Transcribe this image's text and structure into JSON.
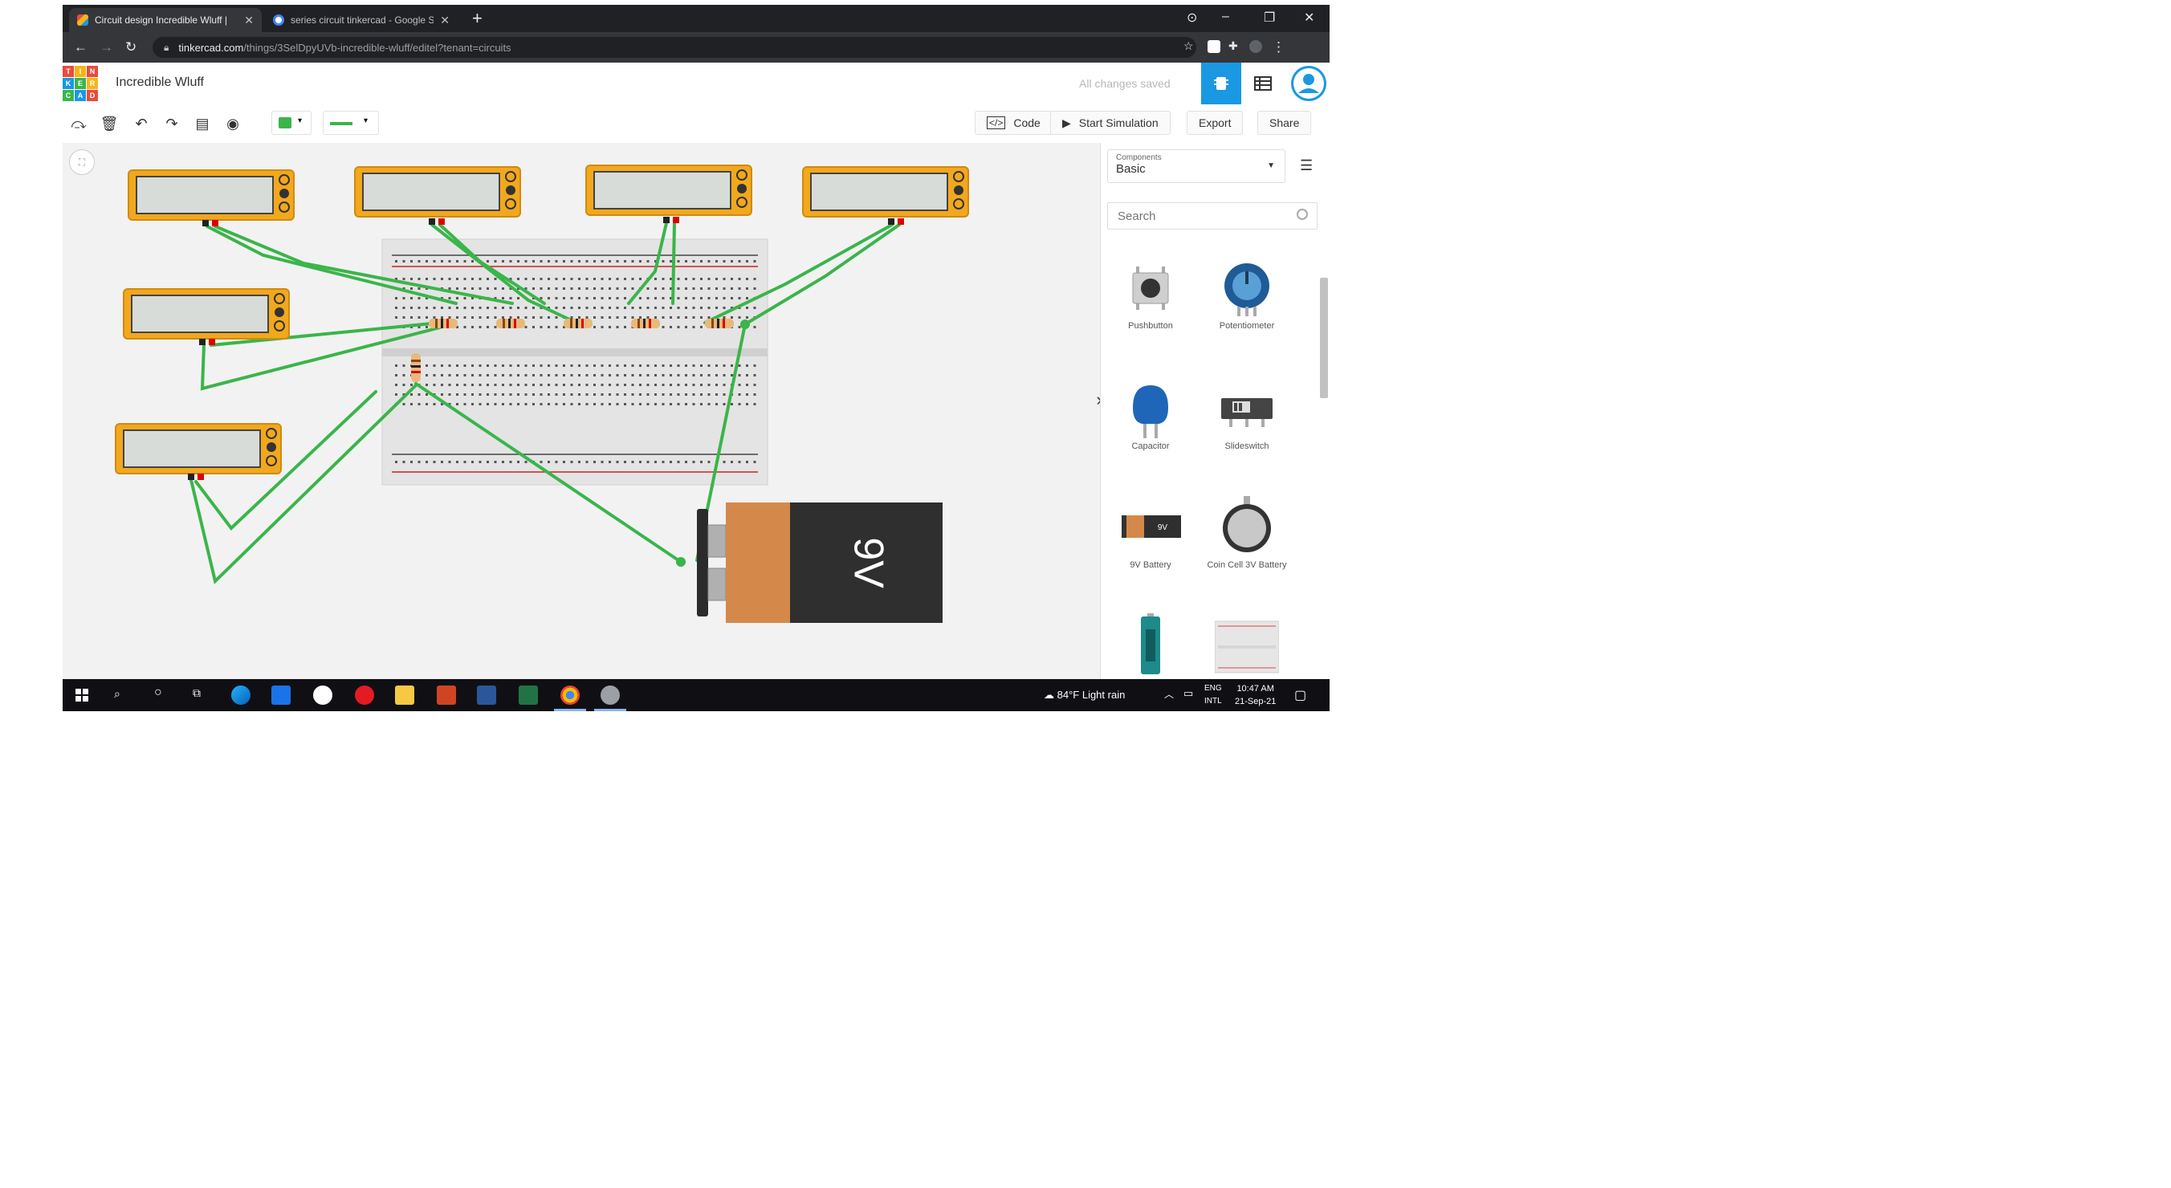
{
  "browser": {
    "tabs": [
      {
        "title": "Circuit design Incredible Wluff |",
        "active": true
      },
      {
        "title": "series circuit tinkercad - Google S",
        "active": false
      }
    ],
    "url_host": "tinkercad.com",
    "url_path": "/things/3SelDpyUVb-incredible-wluff/editel?tenant=circuits"
  },
  "header": {
    "logo_letters": [
      "T",
      "I",
      "N",
      "K",
      "E",
      "R",
      "C",
      "A",
      "D"
    ],
    "project_name": "Incredible Wluff",
    "save_status": "All changes saved"
  },
  "toolbar": {
    "code_label": "Code",
    "start_simulation_label": "Start Simulation",
    "export_label": "Export",
    "share_label": "Share",
    "wire_color": "#3ab54a"
  },
  "panel": {
    "components_label": "Components",
    "components_value": "Basic",
    "search_placeholder": "Search",
    "items": [
      {
        "label": "Pushbutton"
      },
      {
        "label": "Potentiometer"
      },
      {
        "label": "Capacitor"
      },
      {
        "label": "Slideswitch"
      },
      {
        "label": "9V Battery"
      },
      {
        "label": "Coin Cell 3V Battery"
      }
    ]
  },
  "canvas": {
    "battery_label": "9V",
    "battery_small_label": "9V"
  },
  "taskbar": {
    "weather": "84°F  Light rain",
    "lang_top": "ENG",
    "lang_bottom": "INTL",
    "time": "10:47 AM",
    "date": "21-Sep-21"
  },
  "colors": {
    "accent": "#1a98e2",
    "multimeter": "#f2a81d",
    "wire": "#3ab54a",
    "battery_orange": "#d4894a",
    "battery_dark": "#2f2f2f"
  }
}
